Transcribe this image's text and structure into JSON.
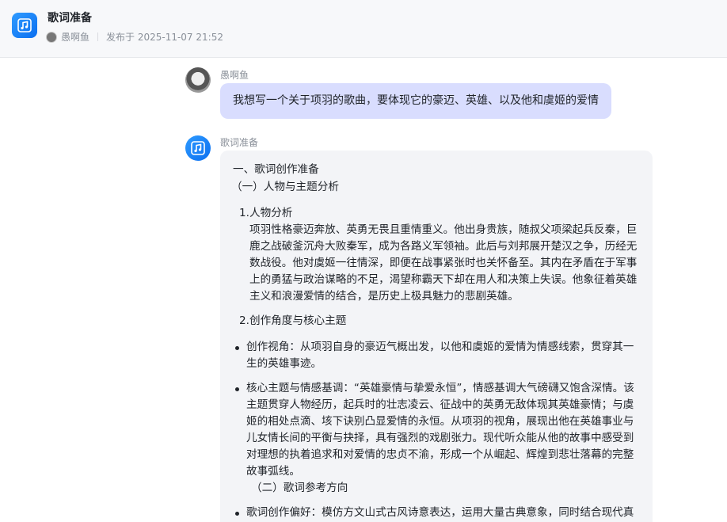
{
  "header": {
    "title": "歌词准备",
    "author": "愚啊鱼",
    "published": "发布于 2025-11-07 21:52"
  },
  "user_message": {
    "sender": "愚啊鱼",
    "text": "我想写一个关于项羽的歌曲，要体现它的豪迈、英雄、以及他和虞姬的爱情"
  },
  "bot_message": {
    "sender": "歌词准备",
    "h1": "一、歌词创作准备",
    "h2": "（一）人物与主题分析",
    "item1_num": "1.",
    "item1_title": "人物分析",
    "item1_body": "项羽性格豪迈奔放、英勇无畏且重情重义。他出身贵族，随叔父项梁起兵反秦，巨鹿之战破釜沉舟大败秦军，成为各路义军领袖。此后与刘邦展开楚汉之争，历经无数战役。他对虞姬一往情深，即便在战事紧张时也关怀备至。其内在矛盾在于军事上的勇猛与政治谋略的不足，渴望称霸天下却在用人和决策上失误。他象征着英雄主义和浪漫爱情的结合，是历史上极具魅力的悲剧英雄。",
    "item2_num": "2.",
    "item2_title": "创作角度与核心主题",
    "bullet1": "创作视角：从项羽自身的豪迈气概出发，以他和虞姬的爱情为情感线索，贯穿其一生的英雄事迹。",
    "bullet2": "核心主题与情感基调：“英雄豪情与挚爱永恒”，情感基调大气磅礴又饱含深情。该主题贯穿人物经历，起兵时的壮志凌云、征战中的英勇无敌体现其英雄豪情；与虞姬的相处点滴、垓下诀别凸显爱情的永恒。从项羽的视角，展现出他在英雄事业与儿女情长间的平衡与抉择，具有强烈的戏剧张力。现代听众能从他的故事中感受到对理想的执着追求和对爱情的忠贞不渝，形成一个从崛起、辉煌到悲壮落幕的完整故事弧线。",
    "h3": "（二）歌词参考方向",
    "bullet3": "歌词创作偏好：模仿方文山式古风诗意表达，运用大量古典意象，同时结合现代真实的情感抒发。"
  },
  "icons": {
    "app_logo": "music-note-icon",
    "bot_avatar": "music-note-icon"
  },
  "colors": {
    "accent": "#1677ff",
    "user_bubble": "#d9ddfe",
    "bot_bubble": "#f3f4f7"
  }
}
